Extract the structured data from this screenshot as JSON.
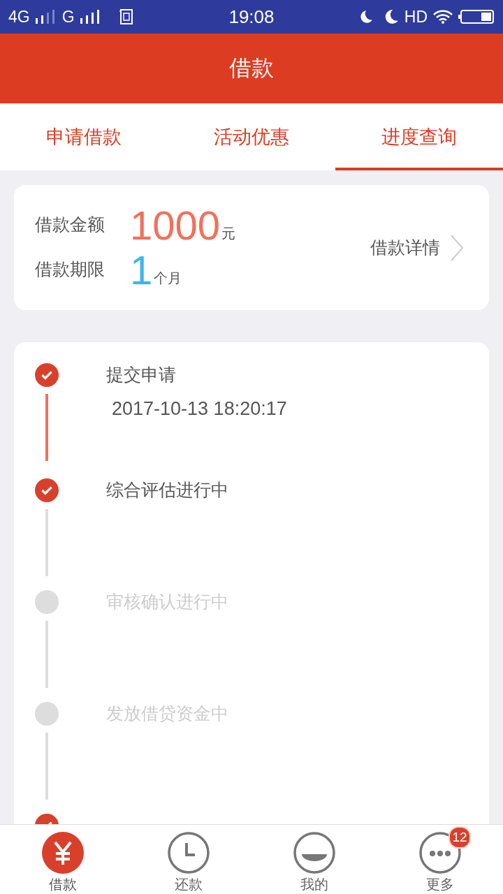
{
  "status_bar": {
    "network_1": "4G",
    "network_2": "G",
    "hd": "HD",
    "time": "19:08"
  },
  "header": {
    "title": "借款"
  },
  "tabs": [
    {
      "label": "申请借款",
      "selected": false
    },
    {
      "label": "活动优惠",
      "selected": false
    },
    {
      "label": "进度查询",
      "selected": true
    }
  ],
  "loan": {
    "amount_label": "借款金额",
    "amount": "1000",
    "amount_unit": "元",
    "term_label": "借款期限",
    "term": "1",
    "term_unit": "个月",
    "details_link": "借款详情"
  },
  "steps": [
    {
      "title": "提交申请",
      "time": "2017-10-13 18:20:17",
      "done": true
    },
    {
      "title": "综合评估进行中",
      "done": true
    },
    {
      "title": "审核确认进行中",
      "done": false
    },
    {
      "title": "发放借贷资金中",
      "done": false
    },
    {
      "done": true
    }
  ],
  "bottom_nav": [
    {
      "label": "借款",
      "kind": "yen",
      "selected": true
    },
    {
      "label": "还款",
      "kind": "clock",
      "selected": false
    },
    {
      "label": "我的",
      "kind": "face",
      "selected": false
    },
    {
      "label": "更多",
      "kind": "more",
      "selected": false,
      "badge": "12"
    }
  ]
}
